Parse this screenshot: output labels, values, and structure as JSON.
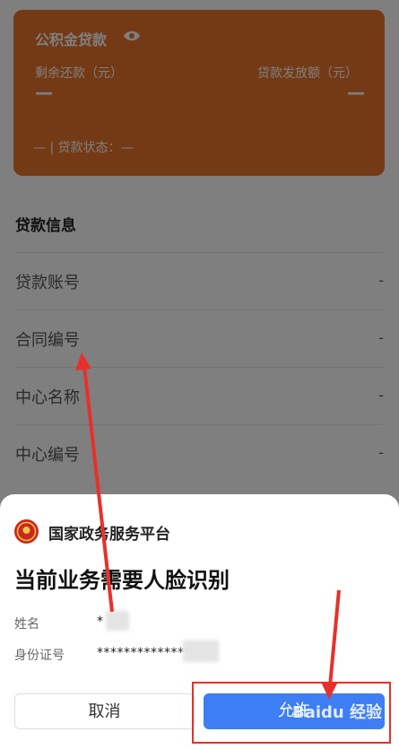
{
  "loan_card": {
    "title": "公积金贷款",
    "remaining_label": "剩余还款（元）",
    "disbursed_label": "贷款发放额（元）",
    "remaining_value": "—",
    "disbursed_value": "—",
    "status_text": "— | 贷款状态：—",
    "color": "#e9742b"
  },
  "loan_info": {
    "section_title": "贷款信息",
    "rows": [
      {
        "label": "贷款账号",
        "value": "-"
      },
      {
        "label": "合同编号",
        "value": "-"
      },
      {
        "label": "中心名称",
        "value": "-"
      },
      {
        "label": "中心编号",
        "value": "-"
      }
    ]
  },
  "dialog": {
    "app_name": "国家政务服务平台",
    "title": "当前业务需要人脸识别",
    "name_label": "姓名",
    "name_value": "*",
    "id_label": "身份证号",
    "id_value": "**************0",
    "cancel_label": "取消",
    "allow_label": "允许",
    "allow_color": "#3d7ef5"
  },
  "watermark": "Baidu 经验",
  "annotation_color": "#e8302a"
}
